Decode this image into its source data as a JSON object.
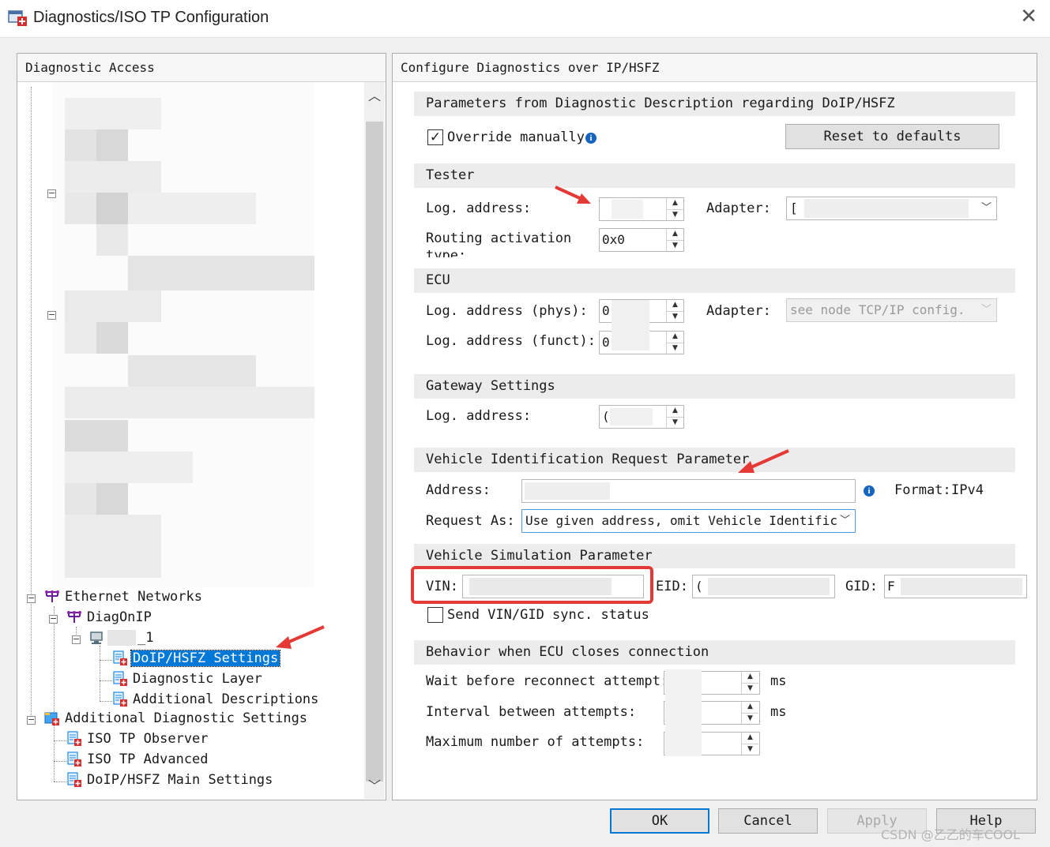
{
  "window": {
    "title": "Diagnostics/ISO TP Configuration",
    "close_icon": "close-icon"
  },
  "left_panel": {
    "header": "Diagnostic Access",
    "tree": {
      "ethernet_networks": "Ethernet Networks",
      "diagonip": "DiagOnIP",
      "node_suffix": "_1",
      "doip_settings": "DoIP/HSFZ Settings",
      "diagnostic_layer": "Diagnostic Layer",
      "additional_descriptions": "Additional Descriptions",
      "additional_diag_settings": "Additional Diagnostic Settings",
      "iso_tp_observer": "ISO TP Observer",
      "iso_tp_advanced": "ISO TP Advanced",
      "doip_main_settings": "DoIP/HSFZ Main Settings"
    }
  },
  "right_panel": {
    "header": "Configure Diagnostics over IP/HSFZ",
    "params_section": {
      "title": "Parameters from Diagnostic Description regarding DoIP/HSFZ",
      "override_label": "Override manually",
      "override_checked": true,
      "reset_button": "Reset to defaults"
    },
    "tester": {
      "title": "Tester",
      "log_address_label": "Log. address:",
      "adapter_label": "Adapter:",
      "adapter_value": "[",
      "routing_label_line1": "Routing activation",
      "routing_label_line2": "type:",
      "routing_value": "0x0"
    },
    "ecu": {
      "title": "ECU",
      "phys_label": "Log. address (phys):",
      "phys_value": "0",
      "funct_label": "Log. address (funct):",
      "funct_value": "0",
      "adapter_label": "Adapter:",
      "adapter_value": "see node TCP/IP config."
    },
    "gateway": {
      "title": "Gateway Settings",
      "log_address_label": "Log. address:",
      "log_address_value": "("
    },
    "vehicle_id": {
      "title": "Vehicle Identification Request Parameter",
      "address_label": "Address:",
      "format_label": "Format:",
      "format_value": "IPv4",
      "request_as_label": "Request As:",
      "request_as_value": "Use given address, omit Vehicle Identific"
    },
    "vehicle_sim": {
      "title": "Vehicle Simulation Parameter",
      "vin_label": "VIN:",
      "eid_label": "EID:",
      "eid_value": "(",
      "gid_label": "GID:",
      "gid_value": "F",
      "send_sync_label": "Send VIN/GID sync. status",
      "send_sync_checked": false
    },
    "behavior": {
      "title": "Behavior when ECU closes connection",
      "wait_label": "Wait before reconnect attempt:",
      "wait_unit": "ms",
      "interval_label": "Interval between attempts:",
      "interval_unit": "ms",
      "max_label": "Maximum number of attempts:"
    }
  },
  "footer": {
    "ok": "OK",
    "cancel": "Cancel",
    "apply": "Apply",
    "help": "Help"
  },
  "watermark": "CSDN @乙乙的车COOL",
  "colors": {
    "selection": "#0078d7",
    "annotation_red": "#e53935",
    "info_blue": "#1565c0"
  }
}
